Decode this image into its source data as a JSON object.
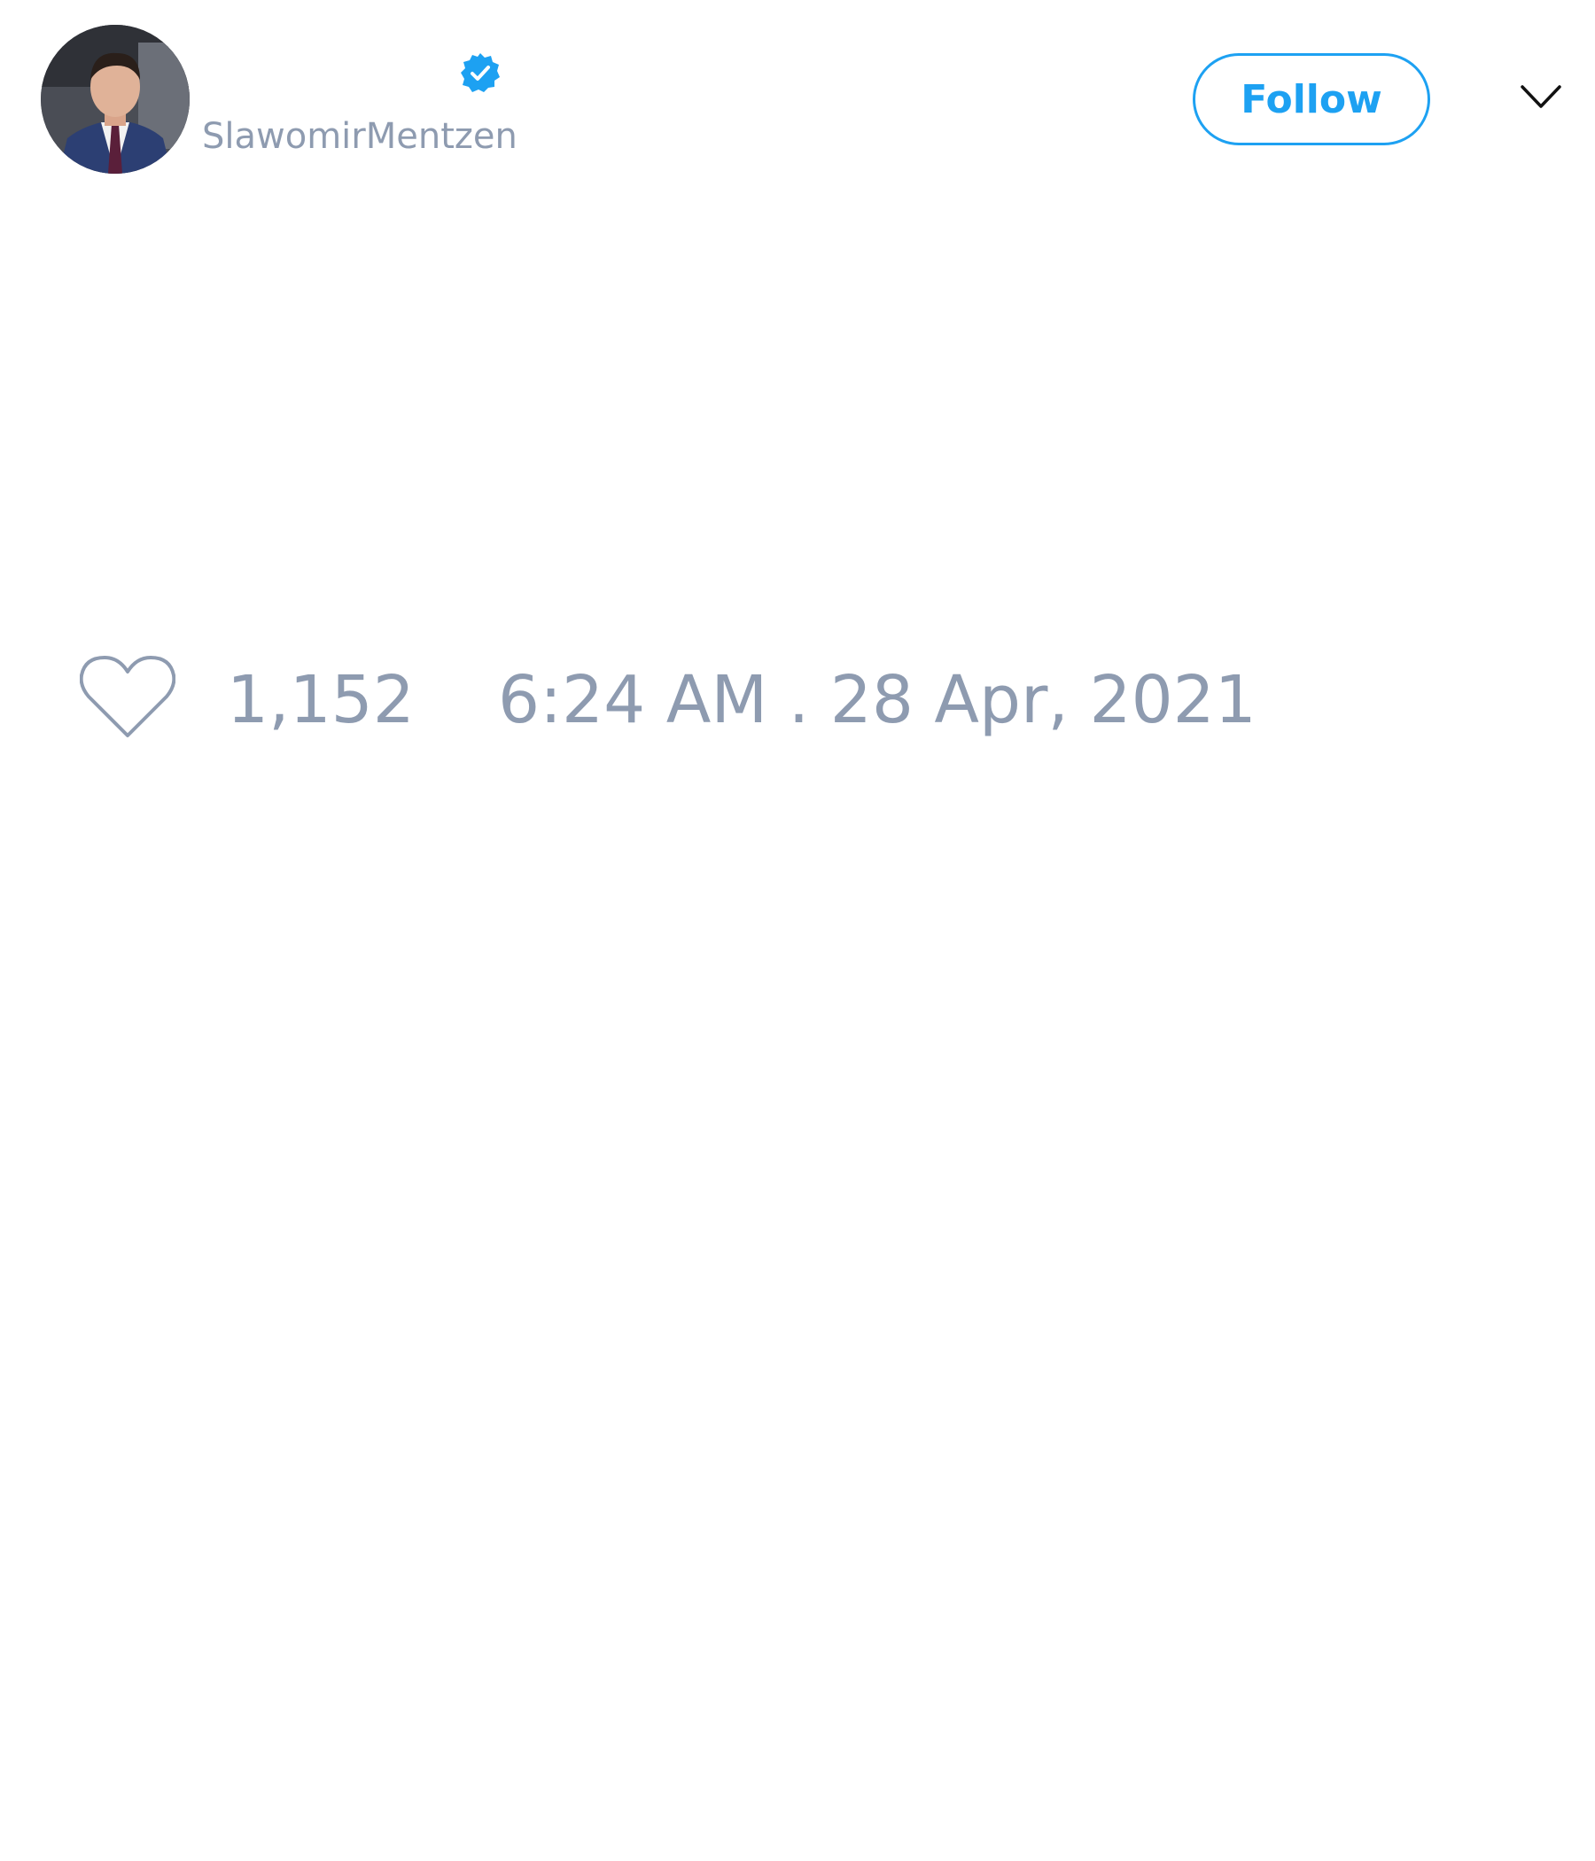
{
  "author": {
    "display_name": "",
    "handle": "SlawomirMentzen",
    "verified": true,
    "avatar_icon": "profile-photo"
  },
  "actions": {
    "follow_label": "Follow",
    "menu_icon": "chevron-down-icon"
  },
  "stats": {
    "like_icon": "heart-outline-icon",
    "like_count": "1,152",
    "timestamp": "6:24 AM . 28 Apr, 2021"
  },
  "colors": {
    "accent": "#1da1f2",
    "muted_text": "#8e9bb0",
    "background": "#ffffff"
  }
}
